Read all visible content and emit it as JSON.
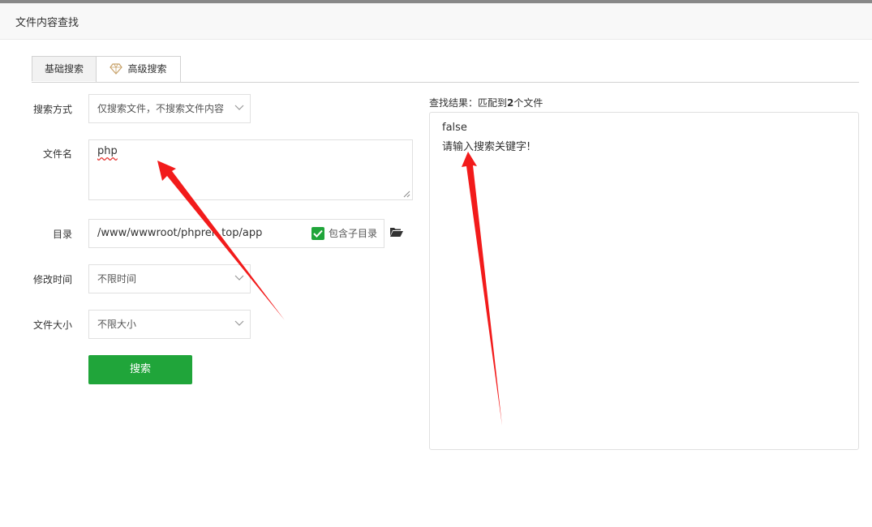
{
  "header": {
    "title": "文件内容查找"
  },
  "tabs": [
    {
      "label": "基础搜索"
    },
    {
      "label": "高级搜索"
    }
  ],
  "form": {
    "mode_label": "搜索方式",
    "mode_value": "仅搜索文件，不搜索文件内容",
    "filename_label": "文件名",
    "filename_value": "php",
    "dir_label": "目录",
    "dir_value": "/www/wwwroot/phpren.top/app",
    "include_sub_label": "包含子目录",
    "include_sub_checked": true,
    "mtime_label": "修改时间",
    "mtime_value": "不限时间",
    "size_label": "文件大小",
    "size_value": "不限大小",
    "search_button": "搜索"
  },
  "result": {
    "header_prefix": "查找结果：匹配到",
    "count": "2",
    "header_suffix": "个文件",
    "lines": [
      "false",
      "请输入搜索关键字!"
    ]
  },
  "colors": {
    "primary": "#20a53a",
    "arrow": "#f21b1b"
  }
}
